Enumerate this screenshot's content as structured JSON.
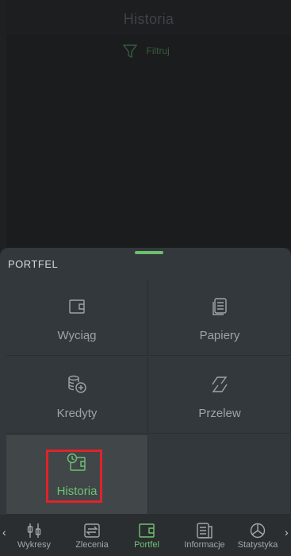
{
  "history": {
    "title": "Historia",
    "filter_label": "Filtruj",
    "filter_icon": "funnel-icon"
  },
  "sheet": {
    "title": "PORTFEL",
    "tiles": [
      {
        "label": "Wyciąg",
        "icon": "wallet-icon",
        "active": false
      },
      {
        "label": "Papiery",
        "icon": "documents-icon",
        "active": false
      },
      {
        "label": "Kredyty",
        "icon": "coins-plus-icon",
        "active": false
      },
      {
        "label": "Przelew",
        "icon": "transfer-icon",
        "active": false
      },
      {
        "label": "Historia",
        "icon": "clock-wallet-icon",
        "active": true
      }
    ]
  },
  "bottom_nav": {
    "items": [
      {
        "label": "Wykresy",
        "icon": "candlestick-icon",
        "active": false
      },
      {
        "label": "Zlecenia",
        "icon": "exchange-icon",
        "active": false
      },
      {
        "label": "Portfel",
        "icon": "wallet-icon",
        "active": true
      },
      {
        "label": "Informacje",
        "icon": "news-icon",
        "active": false
      },
      {
        "label": "Statystyka",
        "icon": "pie-chart-icon",
        "active": false
      }
    ],
    "left_arrow": "‹",
    "right_arrow": "›"
  },
  "colors": {
    "accent": "#6fc472",
    "highlight_box": "#e0232a",
    "sheet_bg": "#33383c"
  }
}
